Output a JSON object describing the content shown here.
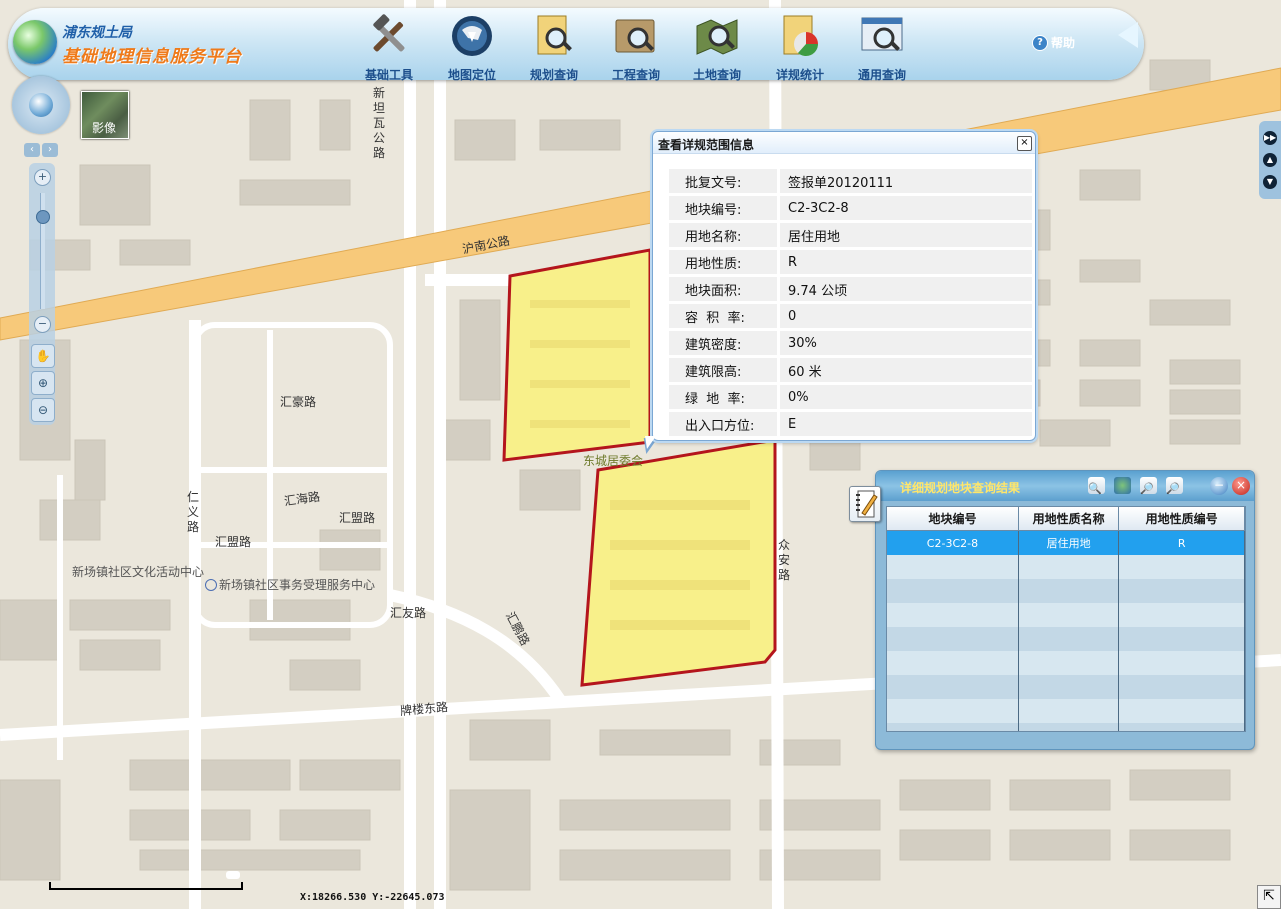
{
  "header": {
    "org_name": "浦东规土局",
    "platform_name": "基础地理信息服务平台",
    "help_label": "帮助",
    "tools": [
      {
        "label": "基础工具",
        "icon": "tools-icon"
      },
      {
        "label": "地图定位",
        "icon": "globe-locate-icon"
      },
      {
        "label": "规划查询",
        "icon": "plan-query-icon"
      },
      {
        "label": "工程查询",
        "icon": "project-query-icon"
      },
      {
        "label": "土地查询",
        "icon": "land-query-icon"
      },
      {
        "label": "详规统计",
        "icon": "statistics-icon"
      },
      {
        "label": "通用查询",
        "icon": "general-query-icon"
      }
    ]
  },
  "map": {
    "imagery_label": "影像",
    "roads": {
      "xintanwa": "新坦瓦公路",
      "hunan": "沪南公路",
      "huihao": "汇豪路",
      "huihai": "汇海路",
      "huimeng1": "汇盟路",
      "huimeng2": "汇盟路",
      "renyi": "仁义路",
      "huiyou": "汇友路",
      "huipeng": "汇鹏路",
      "pailou_east": "牌楼东路",
      "zhongan": "众安路"
    },
    "pois": {
      "culture_center": "新场镇社区文化活动中心",
      "service_center": "新场镇社区事务受理服务中心",
      "dongcheng": "东城居委会"
    }
  },
  "popup": {
    "title": "查看详规范围信息",
    "close_label": "×",
    "rows": [
      {
        "key": "批复文号:",
        "value": "签报单20120111"
      },
      {
        "key": "地块编号:",
        "value": "C2-3C2-8"
      },
      {
        "key": "用地名称:",
        "value": "居住用地"
      },
      {
        "key": "用地性质:",
        "value": "R"
      },
      {
        "key": "地块面积:",
        "value": "9.74 公顷"
      },
      {
        "key": "容  积  率:",
        "value": "0"
      },
      {
        "key": "建筑密度:",
        "value": "30%"
      },
      {
        "key": "建筑限高:",
        "value": "60 米"
      },
      {
        "key": "绿  地  率:",
        "value": "0%"
      },
      {
        "key": "出入口方位:",
        "value": "E"
      }
    ]
  },
  "results": {
    "title": "详细规划地块查询结果",
    "columns": [
      "地块编号",
      "用地性质名称",
      "用地性质编号"
    ],
    "rows": [
      [
        "C2-3C2-8",
        "居住用地",
        "R"
      ]
    ]
  },
  "status": {
    "coordinates": "X:18266.530   Y:-22645.073"
  },
  "colors": {
    "parcel_fill": "#f8f08a",
    "parcel_border": "#b4151c",
    "highway": "#f7c97a",
    "selected_row": "#22a0ee",
    "brand_orange": "#ef7a1a"
  }
}
